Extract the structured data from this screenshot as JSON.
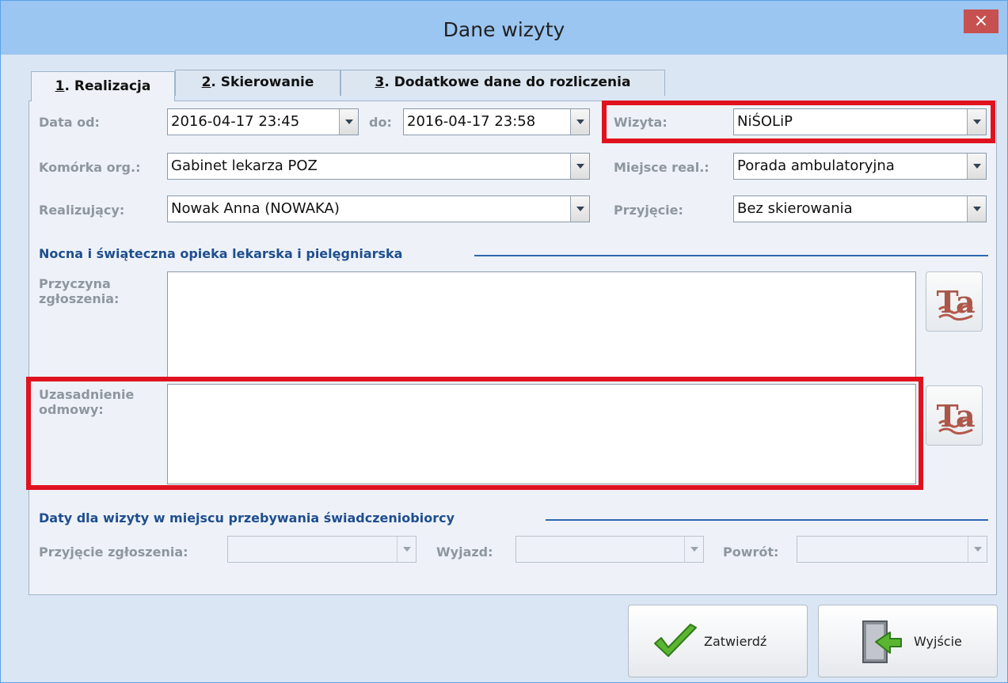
{
  "window": {
    "title": "Dane wizyty",
    "close_glyph": "×"
  },
  "tabs": [
    {
      "key": "1",
      "label": ". Realizacja",
      "active": true
    },
    {
      "key": "2",
      "label": ". Skierowanie",
      "active": false
    },
    {
      "key": "3",
      "label": ". Dodatkowe dane do rozliczenia",
      "active": false
    }
  ],
  "form": {
    "data_od_label": "Data od:",
    "data_od_value": "2016-04-17 23:45",
    "do_label": "do:",
    "do_value": "2016-04-17 23:58",
    "wizyta_label": "Wizyta:",
    "wizyta_value": "NiŚOLiP",
    "komorka_label": "Komórka org.:",
    "komorka_value": "Gabinet lekarza POZ",
    "miejsce_label": "Miejsce real.:",
    "miejsce_value": "Porada ambulatoryjna",
    "realizujacy_label": "Realizujący:",
    "realizujacy_value": "Nowak Anna (NOWAKA)",
    "przyjecie_label": "Przyjęcie:",
    "przyjecie_value": "Bez skierowania"
  },
  "nocna_section": {
    "title": "Nocna i świąteczna opieka lekarska i pielęgniarska",
    "przyczyna_label_1": "Przyczyna",
    "przyczyna_label_2": "zgłoszenia:",
    "przyczyna_value": "",
    "uzasadnienie_label_1": "Uzasadnienie",
    "uzasadnienie_label_2": "odmowy:",
    "uzasadnienie_value": "",
    "text_tool_icon": "text-template-icon"
  },
  "daty_section": {
    "title": "Daty dla wizyty w miejscu przebywania świadczeniobiorcy",
    "przyjecie_label": "Przyjęcie zgłoszenia:",
    "przyjecie_value": "",
    "wyjazd_label": "Wyjazd:",
    "wyjazd_value": "",
    "powrot_label": "Powrót:",
    "powrot_value": ""
  },
  "buttons": {
    "zatwierdz": "Zatwierdź",
    "zatwierdz_icon": "checkmark-icon",
    "wyjscie": "Wyjście",
    "wyjscie_icon": "exit-door-icon"
  },
  "colors": {
    "highlight": "#e1121f",
    "section_heading": "#1f4e8f",
    "title_bar": "#9bc6f1"
  }
}
